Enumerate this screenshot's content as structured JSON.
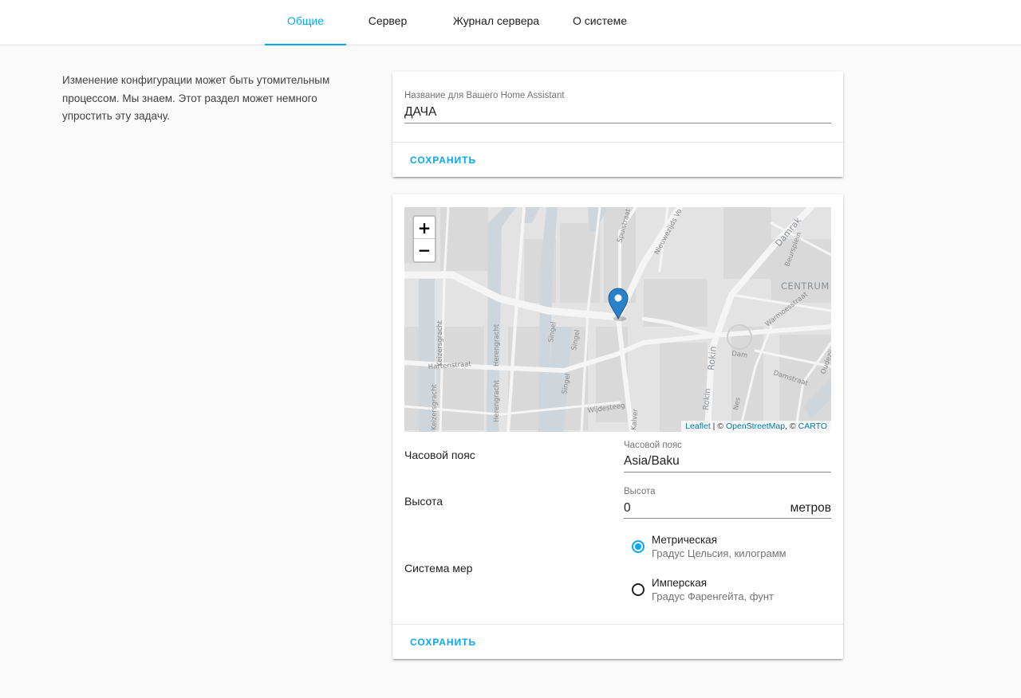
{
  "tabs": [
    {
      "label": "Общие",
      "active": true
    },
    {
      "label": "Сервер",
      "active": false
    },
    {
      "label": "Журнал сервера",
      "active": false
    },
    {
      "label": "О системе",
      "active": false
    }
  ],
  "intro": {
    "line1": "Изменение конфигурации может быть утомительным",
    "line2": "процессом. Мы знаем. Этот раздел может немного",
    "line3": "упростить эту задачу."
  },
  "name_card": {
    "field_label": "Название для Вашего Home Assistant",
    "field_value": "ДАЧА",
    "save_label": "СОХРАНИТЬ"
  },
  "map": {
    "zoom_in": "+",
    "zoom_out": "−",
    "attribution": {
      "leaflet": "Leaflet",
      "sep1": " | © ",
      "osm": "OpenStreetMap",
      "sep2": ", © ",
      "carto": "CARTO"
    },
    "labels": {
      "centrum": "CENTRUM",
      "damrak": "Damrak",
      "rokin": "Rokin",
      "dam": "Dam",
      "damstraat": "Damstraat",
      "hartenstraat": "Hartenstraat",
      "herengracht1": "Herengracht",
      "herengracht2": "Herengracht",
      "keizersgracht1": "Keizersgracht",
      "keizersgracht2": "Keizersgracht",
      "singel1": "Singel",
      "singel2": "Singel",
      "singel3": "Singel",
      "spuistraat": "Spuistraat",
      "nieuwezijds": "Nieuwezijds Vo",
      "wijdesteeg": "Wijdesteeg",
      "beursplein": "Beursplein",
      "warmoesstraat": "Warmoesstraat",
      "oudezijds": "Oudezij",
      "nes": "Nes",
      "kalverstraat": "Kalver"
    },
    "marker_color": "#2a81cb"
  },
  "location_card": {
    "timezone": {
      "row_label": "Часовой пояс",
      "field_label": "Часовой пояс",
      "value": "Asia/Baku"
    },
    "elevation": {
      "row_label": "Высота",
      "field_label": "Высота",
      "value": "0",
      "suffix": "метров"
    },
    "unit_system": {
      "row_label": "Система мер",
      "options": [
        {
          "title": "Метрическая",
          "subtitle": "Градус Цельсия, килограмм",
          "checked": true
        },
        {
          "title": "Имперская",
          "subtitle": "Градус Фаренгейта, фунт",
          "checked": false
        }
      ]
    },
    "save_label": "СОХРАНИТЬ"
  },
  "colors": {
    "accent": "#03a9f4",
    "background": "#fafafa",
    "card": "#ffffff"
  }
}
